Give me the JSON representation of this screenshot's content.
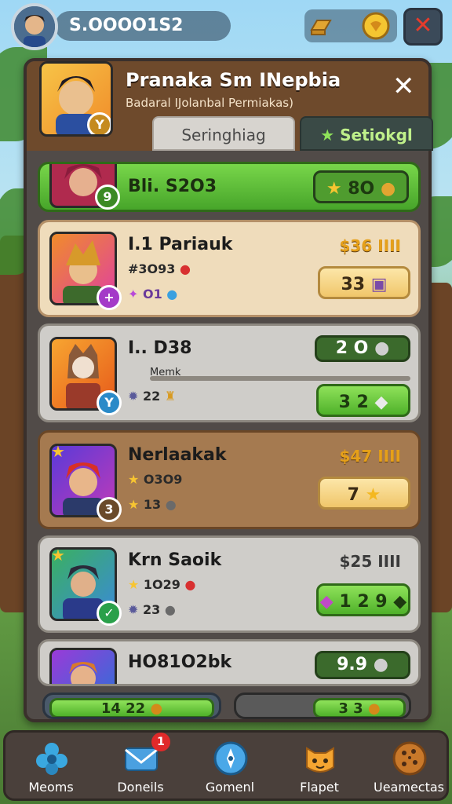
{
  "topbar": {
    "currency_value": "S.OOOO1S2",
    "close_label": "✕"
  },
  "panel": {
    "title": "Pranaka Sm INepbia",
    "subtitle": "Badaral IJolanbal Permiakas)",
    "close_label": "✕",
    "tabs": [
      {
        "label": "Seringhiag"
      },
      {
        "label": "Setiokgl"
      }
    ]
  },
  "rows": [
    {
      "title": "Bli. S2O3",
      "level": "9",
      "button_value": "8O"
    },
    {
      "title": "I.1 Pariauk",
      "stat1": "#3O93",
      "stat2": "O1",
      "level": "+",
      "price": "$36 IIII",
      "button_value": "33"
    },
    {
      "title": "I.. D38",
      "sub_label": "Memk",
      "stat2": "22",
      "level": "Y",
      "top_button": "2 O",
      "button_value": "3 2"
    },
    {
      "title": "Nerlaakak",
      "stat1": "O3O9",
      "stat2": "13",
      "level": "3",
      "price": "$47 IIII",
      "button_value": "7"
    },
    {
      "title": "Krn Saoik",
      "stat1": "1O29",
      "stat2": "23",
      "level": "✓",
      "price": "$25 IIII",
      "button_value": "1 2 9"
    },
    {
      "title": "HO81O2bk",
      "button_value": "9.9"
    },
    {
      "left_value": "14 22",
      "right_value": "3 3"
    }
  ],
  "bottom_nav": [
    {
      "label": "Meoms",
      "icon": "gear-flower-icon"
    },
    {
      "label": "Doneils",
      "icon": "mail-icon",
      "badge": "1"
    },
    {
      "label": "Gomenl",
      "icon": "compass-icon"
    },
    {
      "label": "Flapet",
      "icon": "cat-face-icon"
    },
    {
      "label": "Ueamectas",
      "icon": "cookie-icon"
    }
  ]
}
